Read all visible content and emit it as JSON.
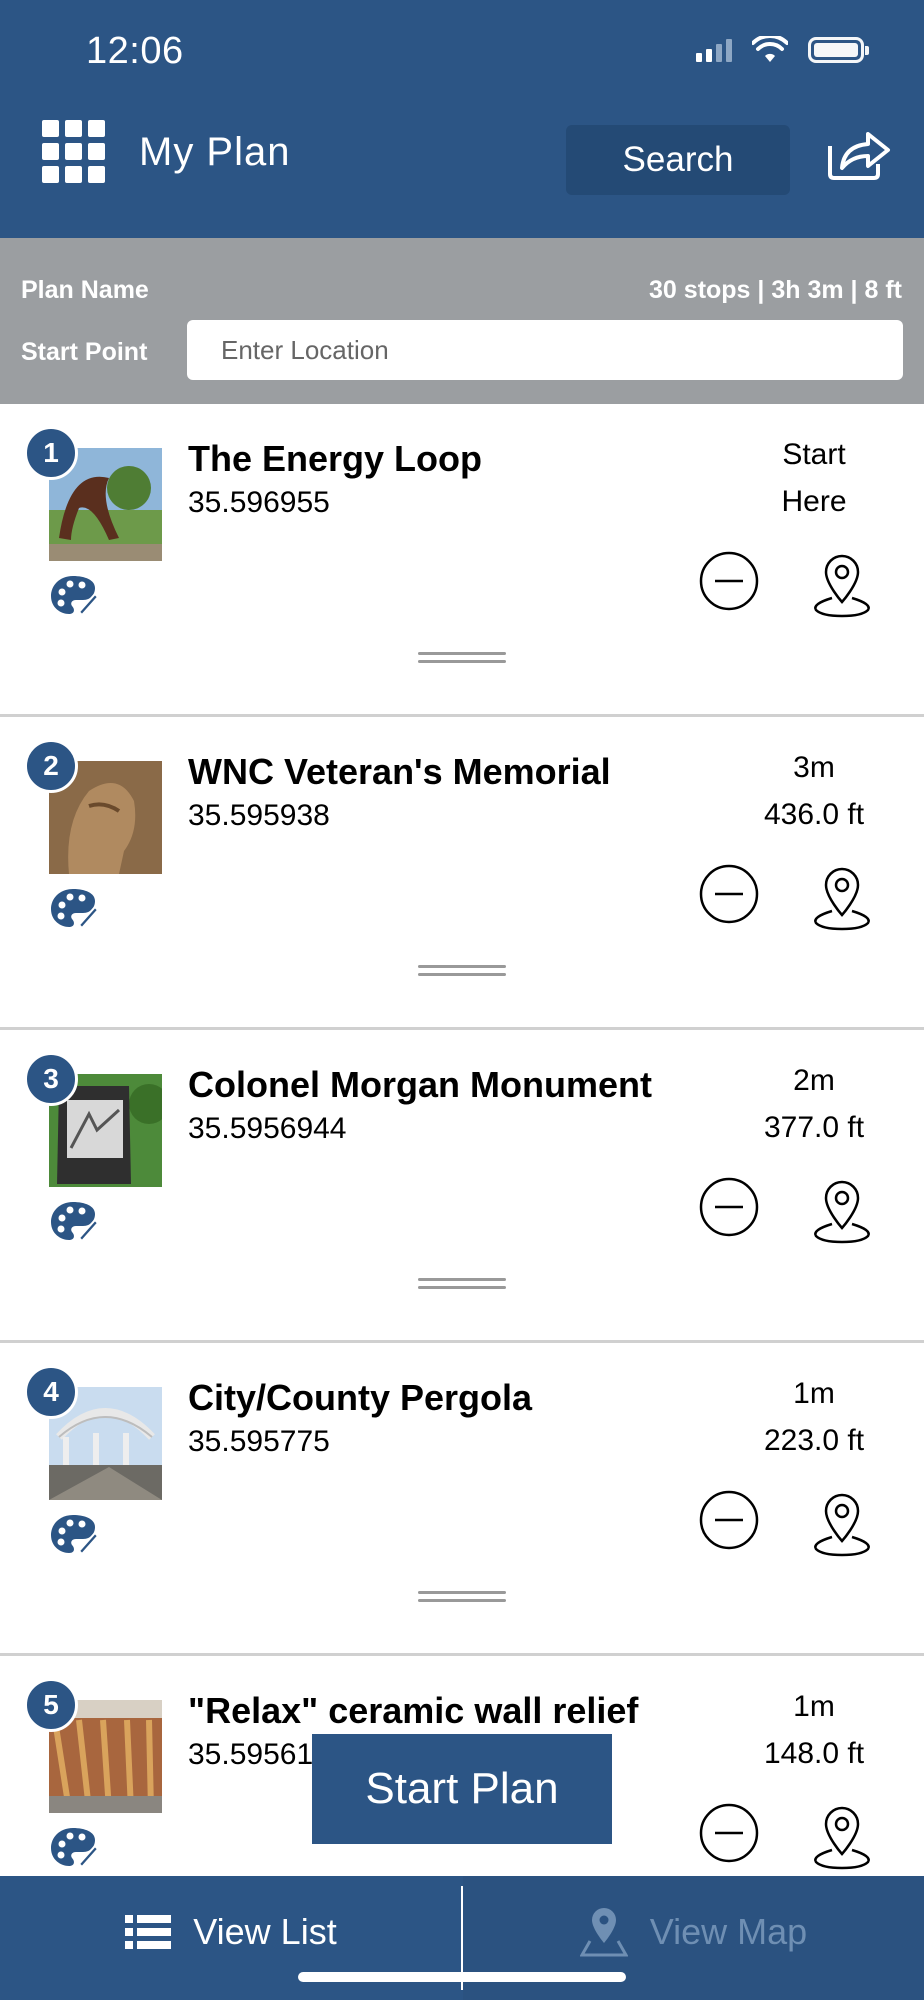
{
  "status": {
    "time": "12:06"
  },
  "header": {
    "title": "My Plan",
    "search_label": "Search"
  },
  "plan": {
    "name_label": "Plan Name",
    "stats": "30 stops | 3h 3m | 8 ft",
    "start_label": "Start Point",
    "start_placeholder": "Enter Location"
  },
  "items": [
    {
      "num": "1",
      "name": "The Energy Loop",
      "coord": "35.596955",
      "time": "Start",
      "dist": "Here"
    },
    {
      "num": "2",
      "name": "WNC Veteran's Memorial",
      "coord": "35.595938",
      "time": "3m",
      "dist": "436.0 ft"
    },
    {
      "num": "3",
      "name": "Colonel Morgan Monument",
      "coord": "35.5956944",
      "time": "2m",
      "dist": "377.0 ft"
    },
    {
      "num": "4",
      "name": "City/County Pergola",
      "coord": "35.595775",
      "time": "1m",
      "dist": "223.0 ft"
    },
    {
      "num": "5",
      "name": "\"Relax\" ceramic wall relief",
      "coord": "35.59561",
      "time": "1m",
      "dist": "148.0 ft"
    }
  ],
  "start_plan_label": "Start Plan",
  "tabs": {
    "list_label": "View List",
    "map_label": "View Map"
  },
  "colors": {
    "primary": "#2c5585",
    "plan_bar": "#9b9ea1"
  },
  "icons": [
    "grid-menu-icon",
    "share-icon",
    "palette-icon",
    "remove-circle-icon",
    "map-pin-icon",
    "list-icon",
    "map-marker-icon"
  ]
}
